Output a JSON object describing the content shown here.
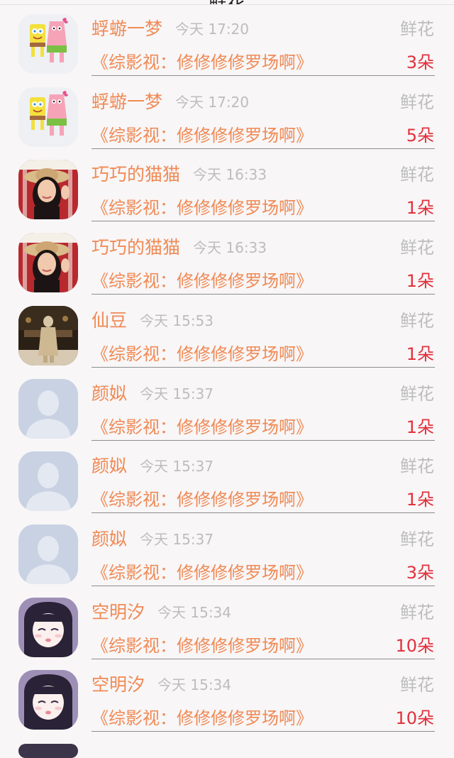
{
  "header": {
    "title": "鲜花"
  },
  "rows": [
    {
      "name": "蜉蝣一梦",
      "time": "今天 17:20",
      "gift": "鲜花",
      "book": "《综影视：修修修修罗场啊》",
      "count": "3朵",
      "avatar": "spongebob-avatar"
    },
    {
      "name": "蜉蝣一梦",
      "time": "今天 17:20",
      "gift": "鲜花",
      "book": "《综影视：修修修修罗场啊》",
      "count": "5朵",
      "avatar": "spongebob-avatar"
    },
    {
      "name": "巧巧的猫猫",
      "time": "今天 16:33",
      "gift": "鲜花",
      "book": "《综影视：修修修修罗场啊》",
      "count": "1朵",
      "avatar": "woman-photo-avatar"
    },
    {
      "name": "巧巧的猫猫",
      "time": "今天 16:33",
      "gift": "鲜花",
      "book": "《综影视：修修修修罗场啊》",
      "count": "1朵",
      "avatar": "woman-photo-avatar"
    },
    {
      "name": "仙豆",
      "time": "今天 15:53",
      "gift": "鲜花",
      "book": "《综影视：修修修修罗场啊》",
      "count": "1朵",
      "avatar": "statue-photo-avatar"
    },
    {
      "name": "颜姒",
      "time": "今天 15:37",
      "gift": "鲜花",
      "book": "《综影视：修修修修罗场啊》",
      "count": "1朵",
      "avatar": "default-user-avatar"
    },
    {
      "name": "颜姒",
      "time": "今天 15:37",
      "gift": "鲜花",
      "book": "《综影视：修修修修罗场啊》",
      "count": "1朵",
      "avatar": "default-user-avatar"
    },
    {
      "name": "颜姒",
      "time": "今天 15:37",
      "gift": "鲜花",
      "book": "《综影视：修修修修罗场啊》",
      "count": "3朵",
      "avatar": "default-user-avatar"
    },
    {
      "name": "空明汐",
      "time": "今天 15:34",
      "gift": "鲜花",
      "book": "《综影视：修修修修罗场啊》",
      "count": "10朵",
      "avatar": "anime-girl-avatar"
    },
    {
      "name": "空明汐",
      "time": "今天 15:34",
      "gift": "鲜花",
      "book": "《综影视：修修修修罗场啊》",
      "count": "10朵",
      "avatar": "anime-girl-avatar"
    }
  ],
  "colors": {
    "name": "#f08a55",
    "count": "#e2303c",
    "muted": "#bdbdbd",
    "background": "#f8f6f7"
  }
}
